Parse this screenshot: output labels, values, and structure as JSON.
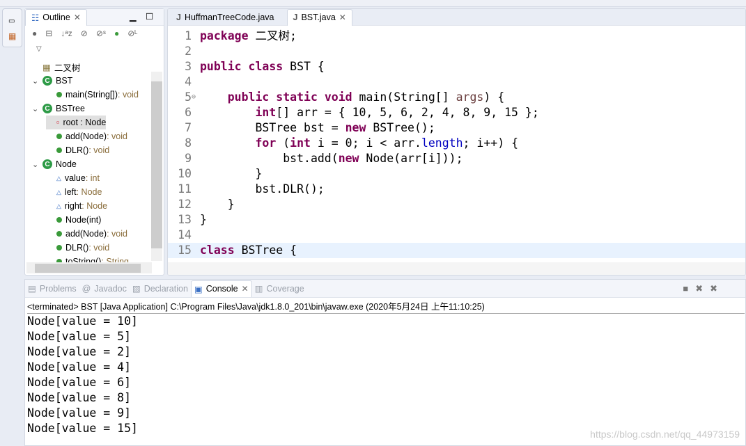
{
  "outline": {
    "title": "Outline",
    "items": [
      {
        "label": "二叉树",
        "type": "",
        "icon": "package-icon",
        "level": 0,
        "twisty": ""
      },
      {
        "label": "BST",
        "type": "",
        "icon": "class-icon",
        "level": 0,
        "twisty": "v"
      },
      {
        "label": "main(String[])",
        "type": " : void",
        "icon": "static-method-icon",
        "level": 1,
        "twisty": ""
      },
      {
        "label": "BSTree",
        "type": "",
        "icon": "class-icon",
        "level": 0,
        "twisty": "v"
      },
      {
        "label": "root : Node",
        "type": "",
        "icon": "private-field-icon",
        "level": 1,
        "twisty": "",
        "selected": true
      },
      {
        "label": "add(Node)",
        "type": " : void",
        "icon": "method-icon",
        "level": 1,
        "twisty": ""
      },
      {
        "label": "DLR()",
        "type": " : void",
        "icon": "method-icon",
        "level": 1,
        "twisty": ""
      },
      {
        "label": "Node",
        "type": "",
        "icon": "class-icon",
        "level": 0,
        "twisty": "v"
      },
      {
        "label": "value",
        "type": " : int",
        "icon": "field-icon",
        "level": 1,
        "twisty": ""
      },
      {
        "label": "left",
        "type": " : Node",
        "icon": "field-icon",
        "level": 1,
        "twisty": ""
      },
      {
        "label": "right",
        "type": " : Node",
        "icon": "field-icon",
        "level": 1,
        "twisty": ""
      },
      {
        "label": "Node(int)",
        "type": "",
        "icon": "constructor-icon",
        "level": 1,
        "twisty": ""
      },
      {
        "label": "add(Node)",
        "type": " : void",
        "icon": "method-icon",
        "level": 1,
        "twisty": ""
      },
      {
        "label": "DLR()",
        "type": " : void",
        "icon": "method-icon",
        "level": 1,
        "twisty": ""
      },
      {
        "label": "toString()",
        "type": " : String",
        "icon": "method-icon",
        "level": 1,
        "twisty": ""
      }
    ]
  },
  "editor": {
    "tabs": [
      {
        "label": "HuffmanTreeCode.java",
        "active": false
      },
      {
        "label": "BST.java",
        "active": true
      }
    ],
    "lines": [
      [
        [
          "kw",
          "package"
        ],
        [
          "t",
          " 二叉树;"
        ]
      ],
      [],
      [
        [
          "kw",
          "public"
        ],
        [
          "t",
          " "
        ],
        [
          "kw",
          "class"
        ],
        [
          "t",
          " BST {"
        ]
      ],
      [],
      [
        [
          "t",
          "    "
        ],
        [
          "kw",
          "public"
        ],
        [
          "t",
          " "
        ],
        [
          "kw",
          "static"
        ],
        [
          "t",
          " "
        ],
        [
          "kw",
          "void"
        ],
        [
          "t",
          " main(String[] "
        ],
        [
          "pm",
          "args"
        ],
        [
          "t",
          ") {"
        ]
      ],
      [
        [
          "t",
          "        "
        ],
        [
          "kw",
          "int"
        ],
        [
          "t",
          "[] arr = { 10, 5, 6, 2, 4, 8, 9, 15 };"
        ]
      ],
      [
        [
          "t",
          "        BSTree bst = "
        ],
        [
          "kw",
          "new"
        ],
        [
          "t",
          " BSTree();"
        ]
      ],
      [
        [
          "t",
          "        "
        ],
        [
          "kw",
          "for"
        ],
        [
          "t",
          " ("
        ],
        [
          "kw",
          "int"
        ],
        [
          "t",
          " i = 0; i < arr."
        ],
        [
          "fd",
          "length"
        ],
        [
          "t",
          "; i++) {"
        ]
      ],
      [
        [
          "t",
          "            bst.add("
        ],
        [
          "kw",
          "new"
        ],
        [
          "t",
          " Node(arr[i]));"
        ]
      ],
      [
        [
          "t",
          "        }"
        ]
      ],
      [
        [
          "t",
          "        bst.DLR();"
        ]
      ],
      [
        [
          "t",
          "    }"
        ]
      ],
      [
        [
          "t",
          "}"
        ]
      ],
      [],
      [
        [
          "kw",
          "class"
        ],
        [
          "t",
          " BSTree {"
        ]
      ]
    ]
  },
  "console": {
    "tabs": [
      {
        "label": "Problems",
        "active": false
      },
      {
        "label": "Javadoc",
        "active": false
      },
      {
        "label": "Declaration",
        "active": false
      },
      {
        "label": "Console",
        "active": true
      },
      {
        "label": "Coverage",
        "active": false
      }
    ],
    "status": "<terminated> BST [Java Application] C:\\Program Files\\Java\\jdk1.8.0_201\\bin\\javaw.exe (2020年5月24日 上午11:10:25)",
    "output": [
      "Node[value = 10]",
      "Node[value = 5]",
      "Node[value = 2]",
      "Node[value = 4]",
      "Node[value = 6]",
      "Node[value = 8]",
      "Node[value = 9]",
      "Node[value = 15]"
    ]
  },
  "watermark": "https://blog.csdn.net/qq_44973159"
}
